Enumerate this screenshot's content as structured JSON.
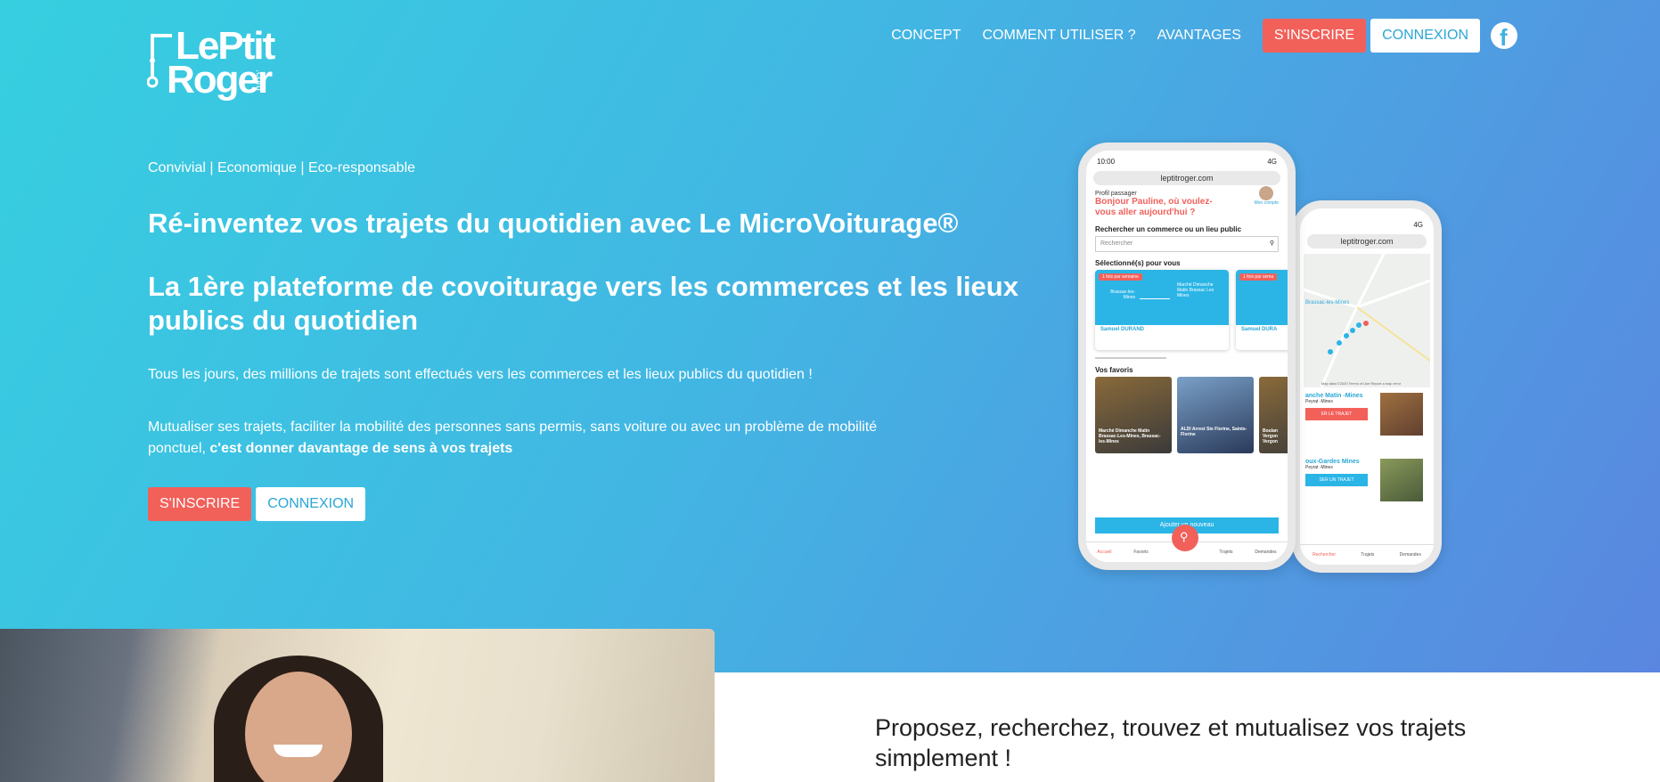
{
  "brand": {
    "logo_line1": "LePtit",
    "logo_line2": "Roger",
    "logo_suffix": ".com"
  },
  "nav": {
    "items": [
      "CONCEPT",
      "COMMENT UTILISER ?",
      "AVANTAGES"
    ],
    "signup_label": "S'INSCRIRE",
    "login_label": "CONNEXION",
    "social_icon": "facebook-icon"
  },
  "hero": {
    "tagline": "Convivial | Economique | Eco-responsable",
    "title": "Ré-inventez vos trajets du quotidien avec Le MicroVoiturage®",
    "subtitle": "La 1ère plateforme de covoiturage vers les commerces et les lieux publics du quotidien",
    "paragraph1": "Tous les jours, des millions de trajets sont effectués vers les commerces et les lieux publics du quotidien !",
    "paragraph2_plain": "Mutualiser ses trajets, faciliter la mobilité des personnes sans permis, sans voiture ou avec un problème de mobilité ponctuel, ",
    "paragraph2_bold": "c'est donner davantage de sens à vos trajets",
    "signup_label": "S'INSCRIRE",
    "login_label": "CONNEXION"
  },
  "phone_front": {
    "time": "10:00",
    "network": "4G",
    "url": "leptitroger.com",
    "profile_label": "Profil passager",
    "greeting": "Bonjour Pauline, où voulez-vous aller aujourd'hui ?",
    "account_label": "Mon compte",
    "search_heading": "Rechercher un commerce ou un lieu public",
    "search_placeholder": "Rechercher",
    "selected_heading": "Sélectionné(s) pour vous",
    "card1_badge": "1 fois par semaine",
    "card1_from": "Brassac-les-Mines",
    "card1_to": "Marché Dimanche Matin Brassac Les Mines",
    "card1_driver": "Samuel DURAND",
    "card2_badge": "1 fois par sema",
    "card2_driver": "Samuel DURA",
    "favorites_heading": "Vos favoris",
    "fav1": "Marché Dimanche Matin Brassac-Les-Mines, Brassac-les-Mines",
    "fav2": "ALDI Arrest Ste Florine, Sainte-Florine",
    "fav3": "Boulan Vergon Vergon",
    "add_new": "Ajouter un nouveau",
    "nav": [
      "Accueil",
      "Favoris",
      "Trajets",
      "Demandes"
    ]
  },
  "phone_back": {
    "network": "4G",
    "url": "leptitroger.com",
    "map_label": "Brassac-les-Mines",
    "map_footer": "Map data ©2020   Terms of Use   Report a map error",
    "item1_title": "anche Matin -Mines",
    "item1_meta": "Peyrat -Mines",
    "item1_btn": "ER LE TRAJET",
    "item2_title": "oux-Gardes Mines",
    "item2_meta": "Peyrat -Mines",
    "item2_btn": "SER UN TRAJET",
    "nav": [
      "Rechercher",
      "Trajets",
      "Demandes"
    ]
  },
  "section": {
    "title": "Proposez, recherchez, trouvez et mutualisez vos trajets simplement !"
  },
  "colors": {
    "accent_red": "#f2605a",
    "accent_blue": "#2ba7d6",
    "hero_start": "#36cfe0",
    "hero_end": "#5a86e0"
  }
}
